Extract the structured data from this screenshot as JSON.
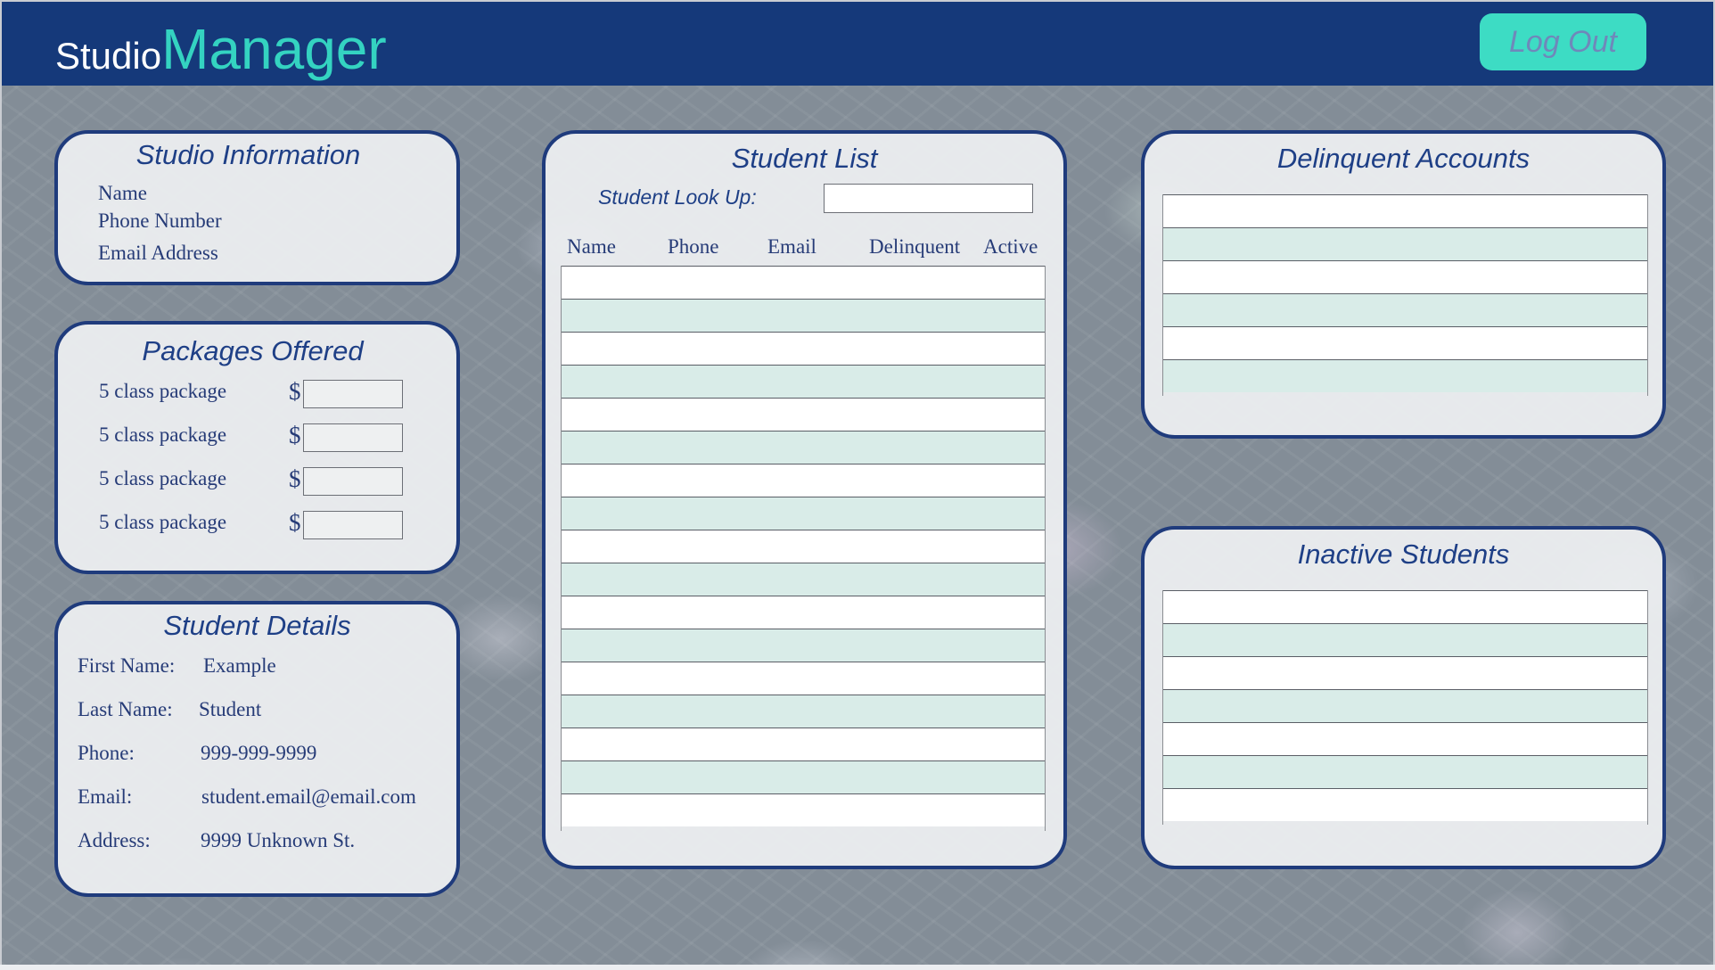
{
  "header": {
    "logo_part1": "Studio",
    "logo_part2": "Manager",
    "logout_label": "Log Out"
  },
  "studio_info": {
    "title": "Studio Information",
    "fields": [
      "Name",
      "Phone Number",
      "Email Address"
    ]
  },
  "packages": {
    "title": "Packages Offered",
    "currency": "$",
    "items": [
      "5 class package",
      "5 class package",
      "5 class package",
      "5 class package"
    ]
  },
  "student_details": {
    "title": "Student Details",
    "rows": [
      {
        "label": "First Name:",
        "value": "Example"
      },
      {
        "label": "Last Name:",
        "value": "Student"
      },
      {
        "label": "Phone:",
        "value": "999-999-9999"
      },
      {
        "label": "Email:",
        "value": "student.email@email.com"
      },
      {
        "label": "Address:",
        "value": "9999 Unknown St."
      }
    ]
  },
  "student_list": {
    "title": "Student List",
    "lookup_label": "Student Look Up:",
    "columns": [
      "Name",
      "Phone",
      "Email",
      "Delinquent",
      "Active"
    ]
  },
  "delinquent_accounts": {
    "title": "Delinquent Accounts"
  },
  "inactive_students": {
    "title": "Inactive Students"
  },
  "colors": {
    "header_bg": "#15397a",
    "accent": "#34d3c1",
    "panel_border": "#1f3b7c",
    "row_alt": "#d9ece8"
  }
}
